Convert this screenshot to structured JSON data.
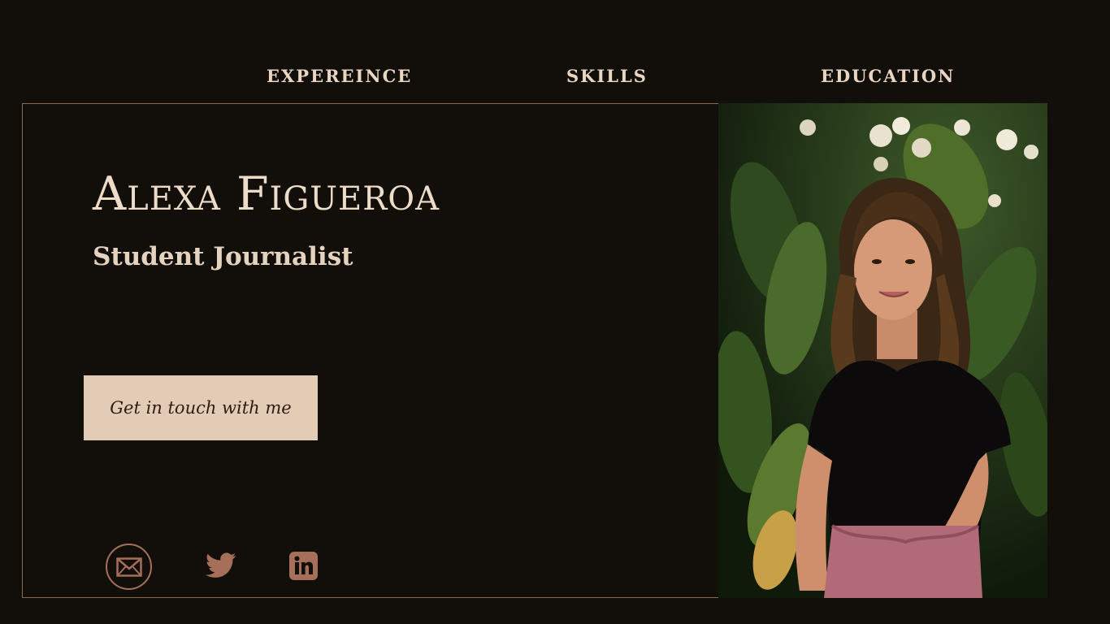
{
  "nav": {
    "items": [
      {
        "label": "EXPEREINCE"
      },
      {
        "label": "SKILLS"
      },
      {
        "label": "EDUCATION"
      }
    ]
  },
  "hero": {
    "name": "Alexa Figueroa",
    "role": "Student Journalist",
    "cta_label": "Get in touch with me"
  },
  "social": {
    "icons": [
      "envelope-icon",
      "twitter-icon",
      "linkedin-icon"
    ]
  },
  "colors": {
    "background": "#120f0b",
    "text": "#e6d3bf",
    "button_bg": "#e3ccb6",
    "icon_accent": "#a56f59",
    "frame_border": "#8c6a4d"
  }
}
